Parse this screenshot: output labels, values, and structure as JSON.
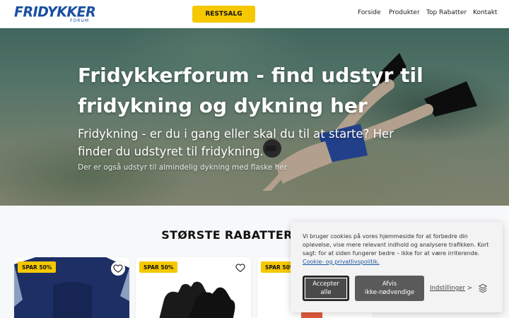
{
  "header": {
    "logo_main": "FRIDYKKER",
    "logo_sub": "FORUM",
    "sale_button": "RESTSALG",
    "nav": [
      "Forside",
      "Produkter",
      "Top Rabatter",
      "Kontakt"
    ]
  },
  "hero": {
    "title": "Fridykkerforum - find udstyr til fridykning og dykning her",
    "subtitle": "Fridykning - er du i gang eller skal du til at starte? Her finder du udstyret til fridykning.",
    "small": "Der er også udstyr til almindelig dykning med flaske her"
  },
  "section": {
    "title": "STØRSTE RABATTER",
    "cards": [
      {
        "badge": "SPAR 50%"
      },
      {
        "badge": "SPAR 50%"
      },
      {
        "badge": "SPAR 50%"
      }
    ]
  },
  "cookie": {
    "text": "Vi bruger cookies på vores hjemmeside for at forbedre din oplevelse, vise mere relevant indhold og analysere trafikken. Kort sagt: for at siden fungerer bedre – ikke for at være irriterende.",
    "link": "Cookie- og privatlivspolitik.",
    "accept_line1": "Accepter",
    "accept_line2": "alle",
    "reject_line1": "Afvis",
    "reject_line2": "ikke-nødvendige",
    "settings": "Indstillinger",
    "settings_arrow": ">"
  },
  "colors": {
    "brand": "#1a4fa0",
    "accent": "#f5c800"
  }
}
